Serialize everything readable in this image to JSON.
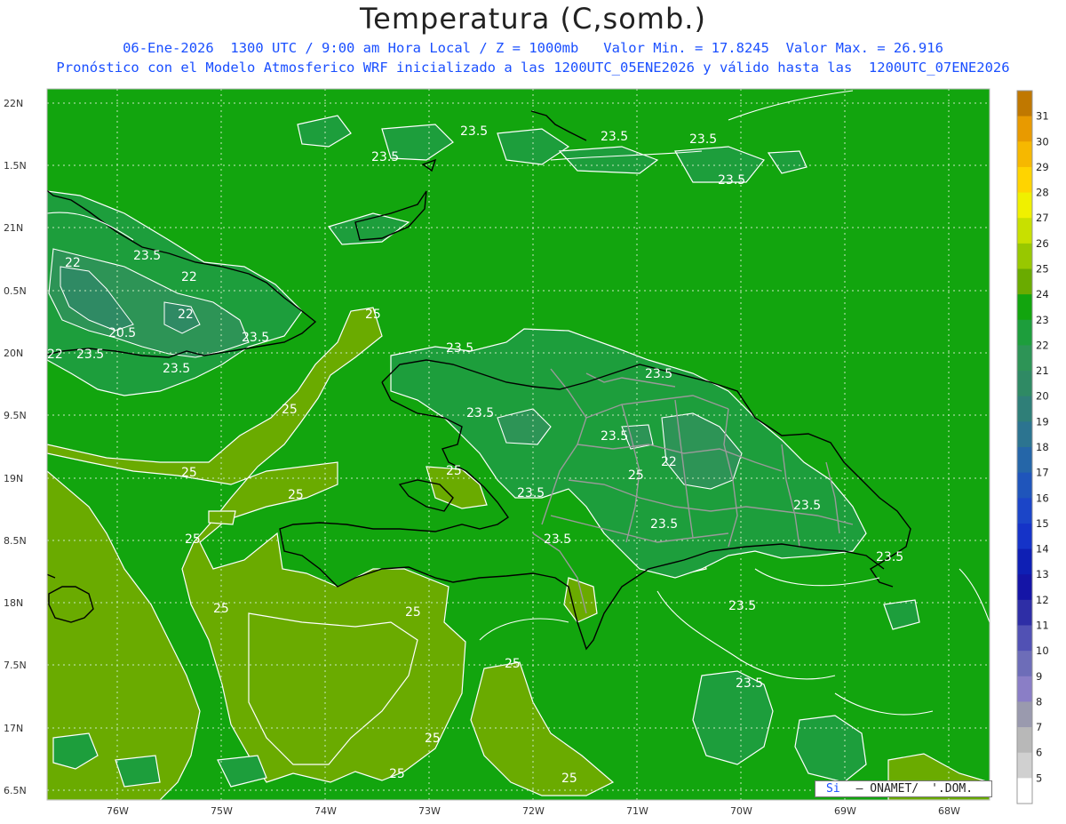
{
  "header": {
    "title": "Temperatura (C,somb.)",
    "line1": "06-Ene-2026  1300 UTC / 9:00 am Hora Local / Z = 1000mb   Valor Min. = 17.8245  Valor Max. = 26.916",
    "line2": "Pronóstico con el Modelo Atmosferico WRF inicializado a las 1200UTC_05ENE2026 y válido hasta las  1200UTC_07ENE2026"
  },
  "map": {
    "lat_labels": [
      "22N",
      "1.5N",
      "21N",
      "0.5N",
      "20N",
      "9.5N",
      "19N",
      "8.5N",
      "18N",
      "7.5N",
      "17N",
      "6.5N"
    ],
    "lon_labels": [
      "76W",
      "75W",
      "74W",
      "73W",
      "72W",
      "71W",
      "70W",
      "69W",
      "68W"
    ],
    "contour_labels": [
      "23.5",
      "23.5",
      "23.5",
      "23.5",
      "22",
      "23.5",
      "22",
      "22",
      "20.5",
      "23.5",
      "22",
      "23.5",
      "23.5",
      "25",
      "23.5",
      "23.5",
      "25",
      "23.5",
      "23.5",
      "25",
      "22",
      "25",
      "25",
      "23.5",
      "23.5",
      "25",
      "23.5",
      "25",
      "23.5",
      "25",
      "25",
      "23.5",
      "25",
      "25",
      "25"
    ],
    "colors": {
      "land_sea_24": "#12a50e",
      "band_25": "#6aab00",
      "band_23": "#1d9e3c",
      "band_22": "#2d9456",
      "band_21": "#2f8a64",
      "grid": "#c8e8c0",
      "coast": "#000000",
      "borders": "#9a9a9a",
      "contour": "#ffffff"
    }
  },
  "colorbar": {
    "labels": [
      "31",
      "30",
      "29",
      "28",
      "27",
      "26",
      "25",
      "24",
      "23",
      "22",
      "21",
      "20",
      "19",
      "18",
      "17",
      "16",
      "15",
      "14",
      "13",
      "12",
      "11",
      "10",
      "9",
      "8",
      "7",
      "6",
      "5"
    ],
    "colors": [
      "#c07800",
      "#e89a00",
      "#f6b800",
      "#ffd400",
      "#f0f000",
      "#c8e000",
      "#98c800",
      "#6aab00",
      "#12a50e",
      "#1d9e3c",
      "#2d9456",
      "#2f8a64",
      "#2f7f78",
      "#2c7490",
      "#2566a8",
      "#1f55bb",
      "#1b45c8",
      "#1533c8",
      "#0e1fb4",
      "#1414a6",
      "#2e2ea6",
      "#5151b4",
      "#6d6db8",
      "#8a7ec6",
      "#9a9aae",
      "#b8b8b8",
      "#d0d0d0",
      "#ffffff"
    ]
  },
  "credit": {
    "part1": "Si",
    "part2": "– ONAMET/",
    "part3": "'.DOM."
  }
}
